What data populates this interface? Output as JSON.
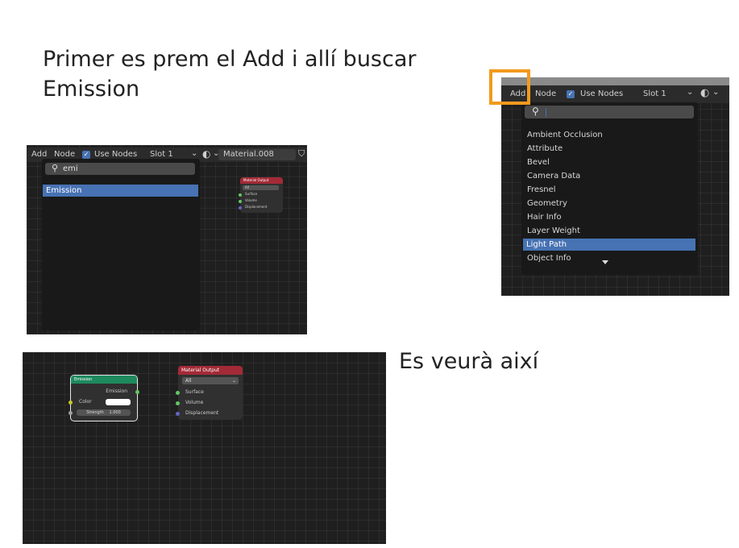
{
  "instructions": {
    "step1_line1": "Primer es prem el Add i allí buscar",
    "step1_line2": "Emission",
    "step2": "Es veurà així"
  },
  "shot1": {
    "header": {
      "add": "Add",
      "node": "Node",
      "use_nodes": "Use Nodes",
      "slot": "Slot 1",
      "material": "Material.008"
    },
    "search_value": "emi",
    "results": [
      "Emission"
    ],
    "output_node": {
      "title": "Material Output",
      "target": "All",
      "sockets": [
        "Surface",
        "Volume",
        "Displacement"
      ]
    }
  },
  "shot2": {
    "header": {
      "add": "Add",
      "node": "Node",
      "use_nodes": "Use Nodes",
      "slot": "Slot 1"
    },
    "menu_items": [
      "Ambient Occlusion",
      "Attribute",
      "Bevel",
      "Camera Data",
      "Fresnel",
      "Geometry",
      "Hair Info",
      "Layer Weight",
      "Light Path",
      "Object Info"
    ],
    "selected_item": "Light Path"
  },
  "shot3": {
    "emission_node": {
      "title": "Emission",
      "output": "Emission",
      "color_label": "Color",
      "strength_label": "Strength",
      "strength_value": "1.000"
    },
    "output_node": {
      "title": "Material Output",
      "target": "All",
      "sockets": [
        "Surface",
        "Volume",
        "Displacement"
      ]
    }
  },
  "colors": {
    "highlight": "#4772b3",
    "callout": "#f29a1d",
    "emission_header": "#1e8a5e",
    "output_header": "#a32a36"
  }
}
